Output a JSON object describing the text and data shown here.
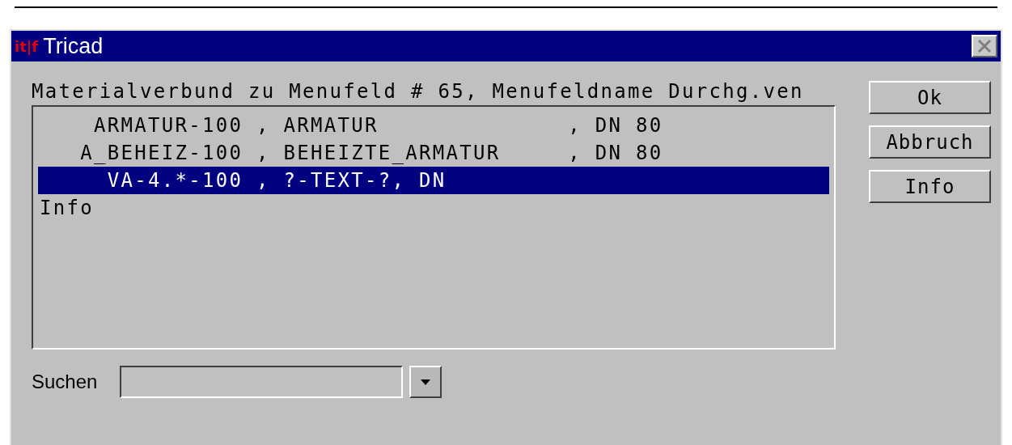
{
  "window": {
    "title": "Tricad",
    "logo": "it|f"
  },
  "heading": "Materialverbund zu Menufeld # 65, Menufeldname Durchg.ven",
  "list": [
    {
      "text": "    ARMATUR-100 , ARMATUR              , DN 80",
      "selected": false
    },
    {
      "text": "   A_BEHEIZ-100 , BEHEIZTE_ARMATUR     , DN 80",
      "selected": false
    },
    {
      "text": "     VA-4.*-100 , ?-TEXT-?, DN",
      "selected": true
    },
    {
      "text": "Info",
      "selected": false
    }
  ],
  "buttons": [
    "Ok",
    "Abbruch",
    "Info"
  ],
  "search": {
    "label": "Suchen"
  }
}
